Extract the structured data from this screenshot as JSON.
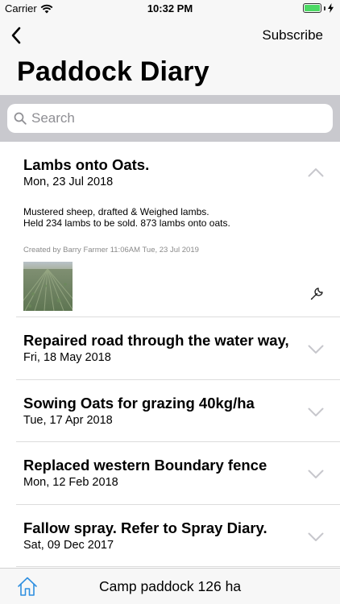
{
  "status": {
    "carrier": "Carrier",
    "time": "10:32 PM"
  },
  "nav": {
    "subscribe": "Subscribe",
    "title": "Paddock Diary"
  },
  "search": {
    "placeholder": "Search"
  },
  "entries": [
    {
      "title": "Lambs onto Oats.",
      "date": "Mon, 23 Jul 2018",
      "expanded": true,
      "notes": [
        "Mustered sheep, drafted & Weighed lambs.",
        "Held 234 lambs to be sold. 873 lambs onto oats."
      ],
      "created_by": "Created by Barry Farmer 11:06AM Tue, 23 Jul 2019"
    },
    {
      "title": "Repaired road through the water way,",
      "date": "Fri, 18 May 2018",
      "expanded": false
    },
    {
      "title": "Sowing Oats for grazing 40kg/ha",
      "date": "Tue, 17 Apr 2018",
      "expanded": false
    },
    {
      "title": "Replaced western Boundary fence",
      "date": "Mon, 12 Feb 2018",
      "expanded": false
    },
    {
      "title": "Fallow spray. Refer to Spray Diary.",
      "date": "Sat, 09 Dec 2017",
      "expanded": false
    }
  ],
  "tab_bar": {
    "label": "Camp paddock 126 ha"
  },
  "icons": {
    "back": "chevron-left-icon",
    "search": "magnifier-icon",
    "collapse": "chevron-up-icon",
    "expand": "chevron-down-icon",
    "edit": "wrench-icon",
    "home": "home-icon",
    "wifi": "wifi-icon",
    "battery": "battery-icon",
    "charging": "bolt-icon"
  },
  "colors": {
    "accent": "#2f8fe0",
    "battery": "#4cd964",
    "search_bg": "#c9c9ce"
  }
}
